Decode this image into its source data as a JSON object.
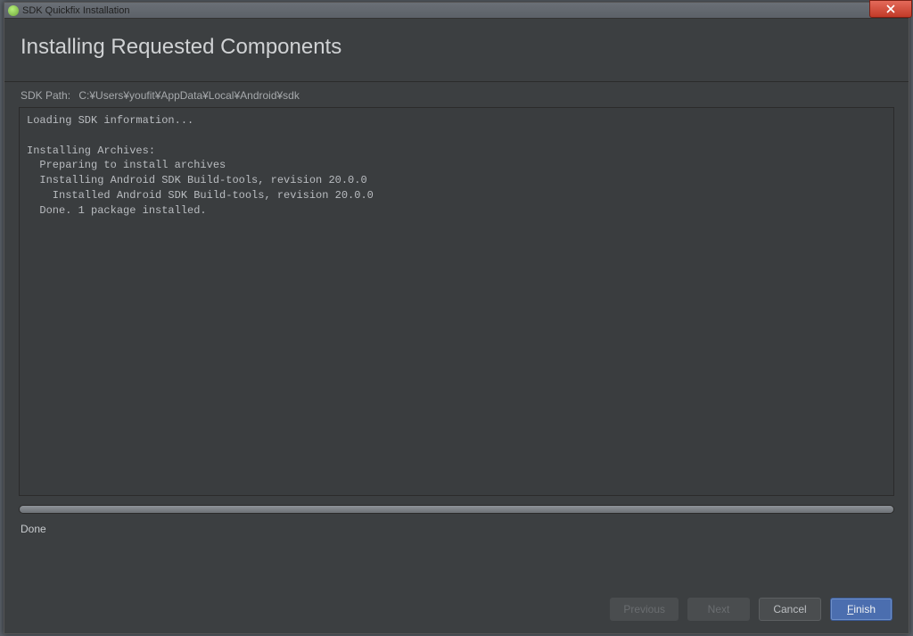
{
  "window": {
    "title": "SDK Quickfix Installation"
  },
  "header": {
    "title": "Installing Requested Components"
  },
  "path": {
    "label": "SDK Path:",
    "value": "C:¥Users¥youfit¥AppData¥Local¥Android¥sdk"
  },
  "log": {
    "lines": [
      "Loading SDK information...",
      "",
      "Installing Archives:",
      "  Preparing to install archives",
      "  Installing Android SDK Build-tools, revision 20.0.0",
      "    Installed Android SDK Build-tools, revision 20.0.0",
      "  Done. 1 package installed."
    ]
  },
  "status": {
    "text": "Done",
    "progress_pct": 100
  },
  "buttons": {
    "previous": "Previous",
    "next": "Next",
    "cancel": "Cancel",
    "finish_prefix": "F",
    "finish_rest": "inish"
  }
}
